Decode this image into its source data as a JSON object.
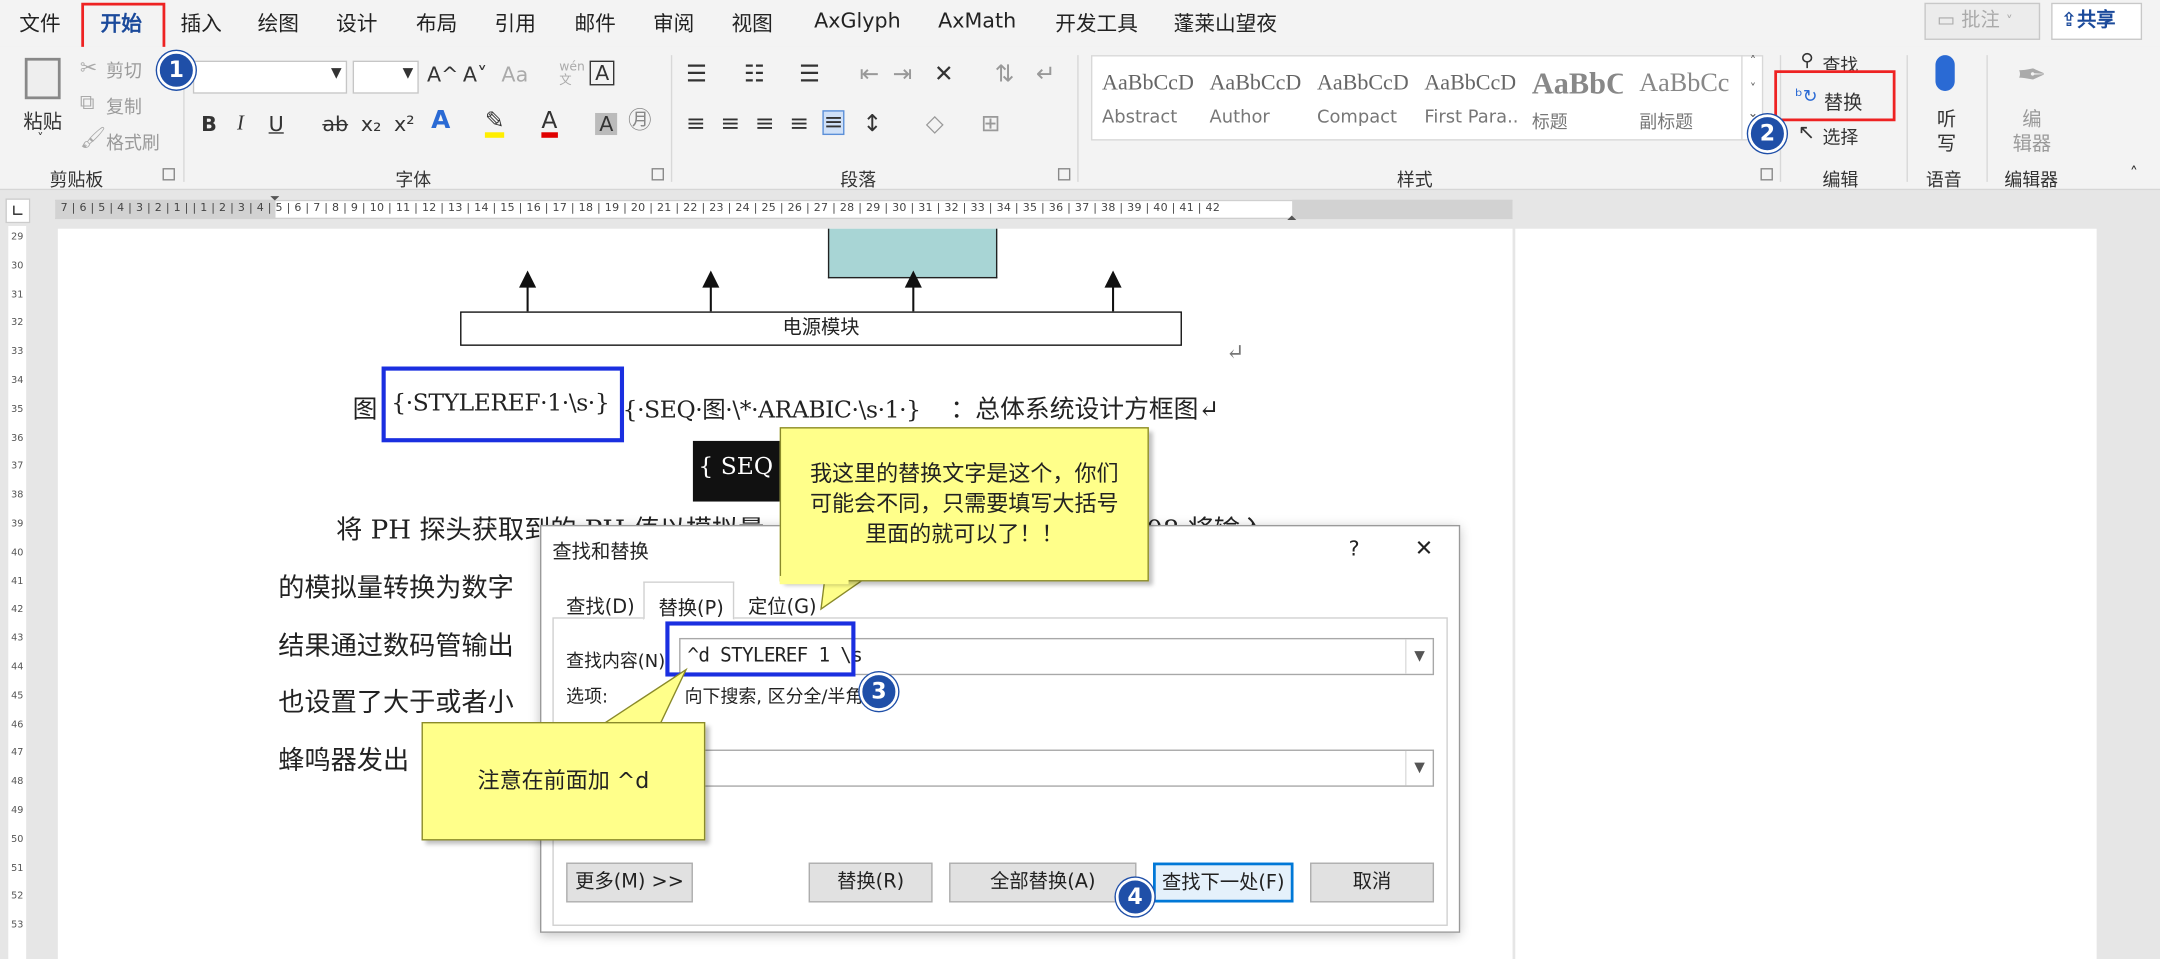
{
  "menu": {
    "tabs": [
      "文件",
      "开始",
      "插入",
      "绘图",
      "设计",
      "布局",
      "引用",
      "邮件",
      "审阅",
      "视图",
      "AxGlyph",
      "AxMath",
      "开发工具",
      "蓬莱山望夜"
    ],
    "comment_label": "批注",
    "share_label": "共享"
  },
  "ribbon": {
    "clipboard": {
      "paste": "粘贴",
      "cut": "剪切",
      "copy": "复制",
      "format_painter": "格式刷",
      "group": "剪贴板"
    },
    "font": {
      "group": "字体",
      "bold": "B",
      "italic": "I",
      "underline": "U",
      "strike": "ab",
      "sub": "x₂",
      "sup": "x²",
      "grow": "A^",
      "shrink": "A˅",
      "case": "Aa",
      "wen": "wén 文",
      "border": "A"
    },
    "paragraph": {
      "group": "段落"
    },
    "styles": {
      "group": "样式",
      "tiles": [
        {
          "preview": "AaBbCcDd",
          "name": "Abstract"
        },
        {
          "preview": "AaBbCcD",
          "name": "Author"
        },
        {
          "preview": "AaBbCcD",
          "name": "Compact"
        },
        {
          "preview": "AaBbCcD",
          "name": "First Para..."
        },
        {
          "preview": "AaBbC",
          "name": "标题"
        },
        {
          "preview": "AaBbCc",
          "name": "副标题"
        }
      ]
    },
    "editing": {
      "find": "查找",
      "replace": "替换",
      "select": "选择",
      "group": "编辑"
    },
    "voice": {
      "dictate_1": "听",
      "dictate_2": "写",
      "group": "语音"
    },
    "editor": {
      "label_1": "编",
      "label_2": "辑器",
      "group": "编辑器"
    }
  },
  "ruler": {
    "numbers": "7 | 6 | 5 | 4 | 3 | 2 | 1 |    | 1 | 2 | 3 | 4 | 5 | 6 | 7 | 8 | 9 | 10 | 11 | 12 | 13 | 14 | 15 | 16 | 17 | 18 | 19 | 20 | 21 | 22 | 23 | 24 | 25 | 26 | 27 | 28 | 29 | 30 | 31 | 32 | 33 | 34 | 35 | 36 | 37 | 38 | 39 | 40 | 41 | 42",
    "vertical": [
      "29",
      "30",
      "31",
      "32",
      "33",
      "34",
      "35",
      "36",
      "37",
      "38",
      "39",
      "40",
      "41",
      "42",
      "43",
      "44",
      "45",
      "46",
      "47",
      "48",
      "49",
      "50",
      "51",
      "52",
      "53"
    ]
  },
  "document": {
    "diagram_box": "电源模块",
    "caption_prefix": "图",
    "field1": "{·STYLEREF·1·\\s·}",
    "field2": "{·SEQ·图·\\*·ARABIC·\\s·1·}",
    "caption_suffix": "：总体系统设计方框图↵",
    "selected_field": "{ SEQ s",
    "para_line1_a": "将 PH 探头获取到的 PH 值以模拟量",
    "para_line1_b": "08 将输入",
    "para_line2": "的模拟量转换为数字",
    "para_line3": "结果通过数码管输出",
    "para_line4": "也设置了大于或者小",
    "para_line5": "蜂鸣器发出",
    "return_mark": "↵"
  },
  "callouts": {
    "top": "我这里的替换文字是这个，你们可能会不同，只需要填写大括号里面的就可以了！！",
    "bottom": "注意在前面加 ^d"
  },
  "badges": [
    "1",
    "2",
    "3",
    "4"
  ],
  "dialog": {
    "title": "查找和替换",
    "help": "?",
    "close": "✕",
    "tabs": [
      "查找(D)",
      "替换(P)",
      "定位(G)"
    ],
    "find_label": "查找内容(N):",
    "find_value": "^d STYLEREF 1 \\s",
    "options_label": "选项:",
    "options_value": "向下搜索, 区分全/半角",
    "replace_fragment": "=",
    "buttons": {
      "more": "更多(M) >>",
      "replace": "替换(R)",
      "replace_all": "全部替换(A)",
      "find_next": "查找下一处(F)",
      "cancel": "取消"
    }
  },
  "colors": {
    "accent": "#1b4a9b",
    "red_box": "#e22222",
    "blue_box": "#1a2fe0",
    "callout": "#ffff8a",
    "badge": "#1f4fa8",
    "diagram_fill": "#a8d5d5"
  }
}
